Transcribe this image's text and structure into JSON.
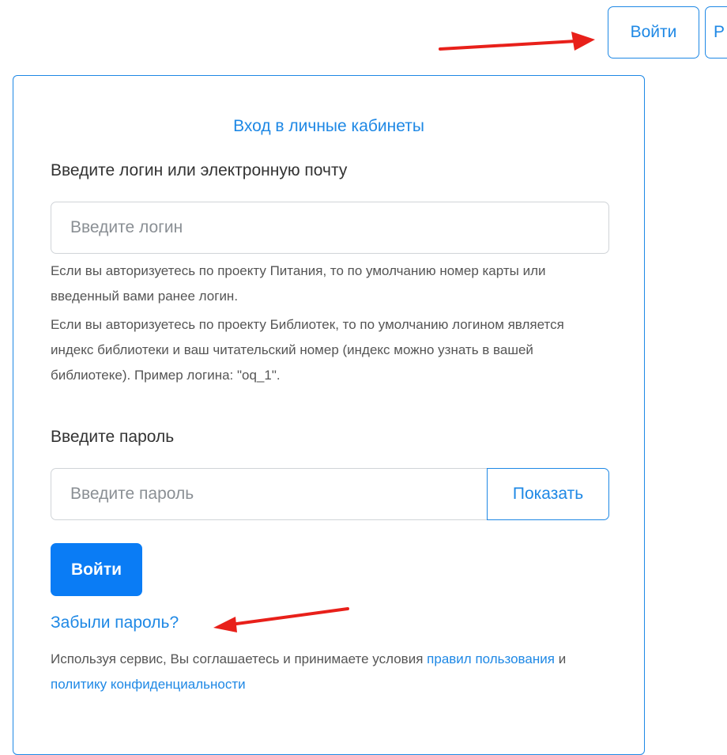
{
  "header": {
    "login_button": "Войти",
    "next_button": "Р"
  },
  "card": {
    "title": "Вход в личные кабинеты",
    "login_label": "Введите логин или электронную почту",
    "login_placeholder": "Введите логин",
    "help_nutrition": "Если вы авторизуетесь по проекту Питания, то по умолчанию номер карты или введенный вами ранее логин.",
    "help_library": "Если вы авторизуетесь по проекту Библиотек, то по умолчанию логином является индекс библиотеки и ваш читательский номер (индекс можно узнать в вашей библиотеке). Пример логина: \"oq_1\".",
    "password_label": "Введите пароль",
    "password_placeholder": "Введите пароль",
    "show_button": "Показать",
    "submit_button": "Войти",
    "forgot_link": "Забыли пароль?",
    "terms_prefix": "Используя сервис, Вы соглашаетесь и принимаете условия",
    "terms_link_rules": "правил пользования",
    "terms_and": "и",
    "terms_link_privacy": "политику конфиденциальности"
  },
  "colors": {
    "accent": "#1e88e5",
    "primary_button": "#0a7cf5",
    "annotation_arrow": "#e8201a"
  }
}
